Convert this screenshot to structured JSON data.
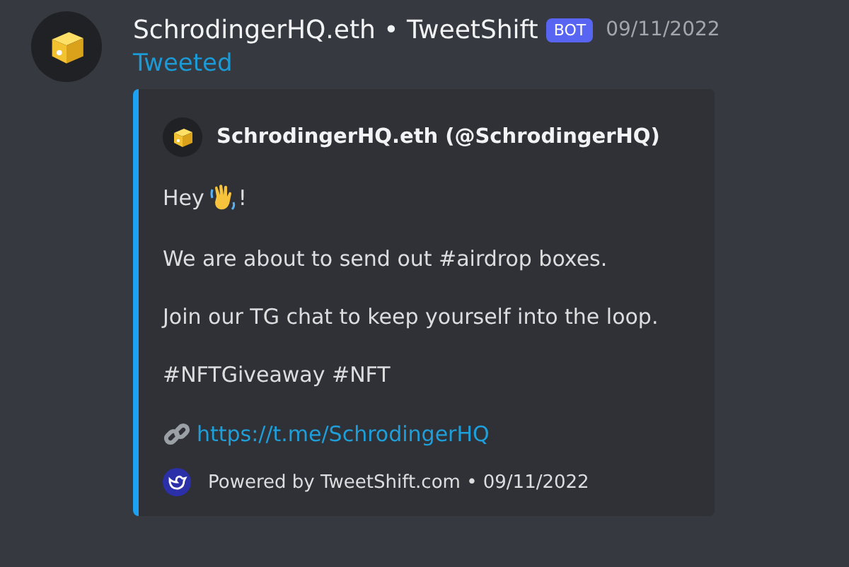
{
  "message": {
    "author": "SchrodingerHQ.eth • TweetShift",
    "badge": "BOT",
    "timestamp": "09/11/2022",
    "action": "Tweeted",
    "embed": {
      "author": "SchrodingerHQ.eth (@SchrodingerHQ)",
      "greeting": {
        "before": "Hey",
        "after": "!"
      },
      "paragraphs": [
        "We are about to send out #airdrop boxes.",
        "Join our TG chat to keep yourself into the loop.",
        "#NFTGiveaway #NFT"
      ],
      "link": "https://t.me/SchrodingerHQ",
      "footer": "Powered by TweetShift.com • 09/11/2022"
    }
  }
}
